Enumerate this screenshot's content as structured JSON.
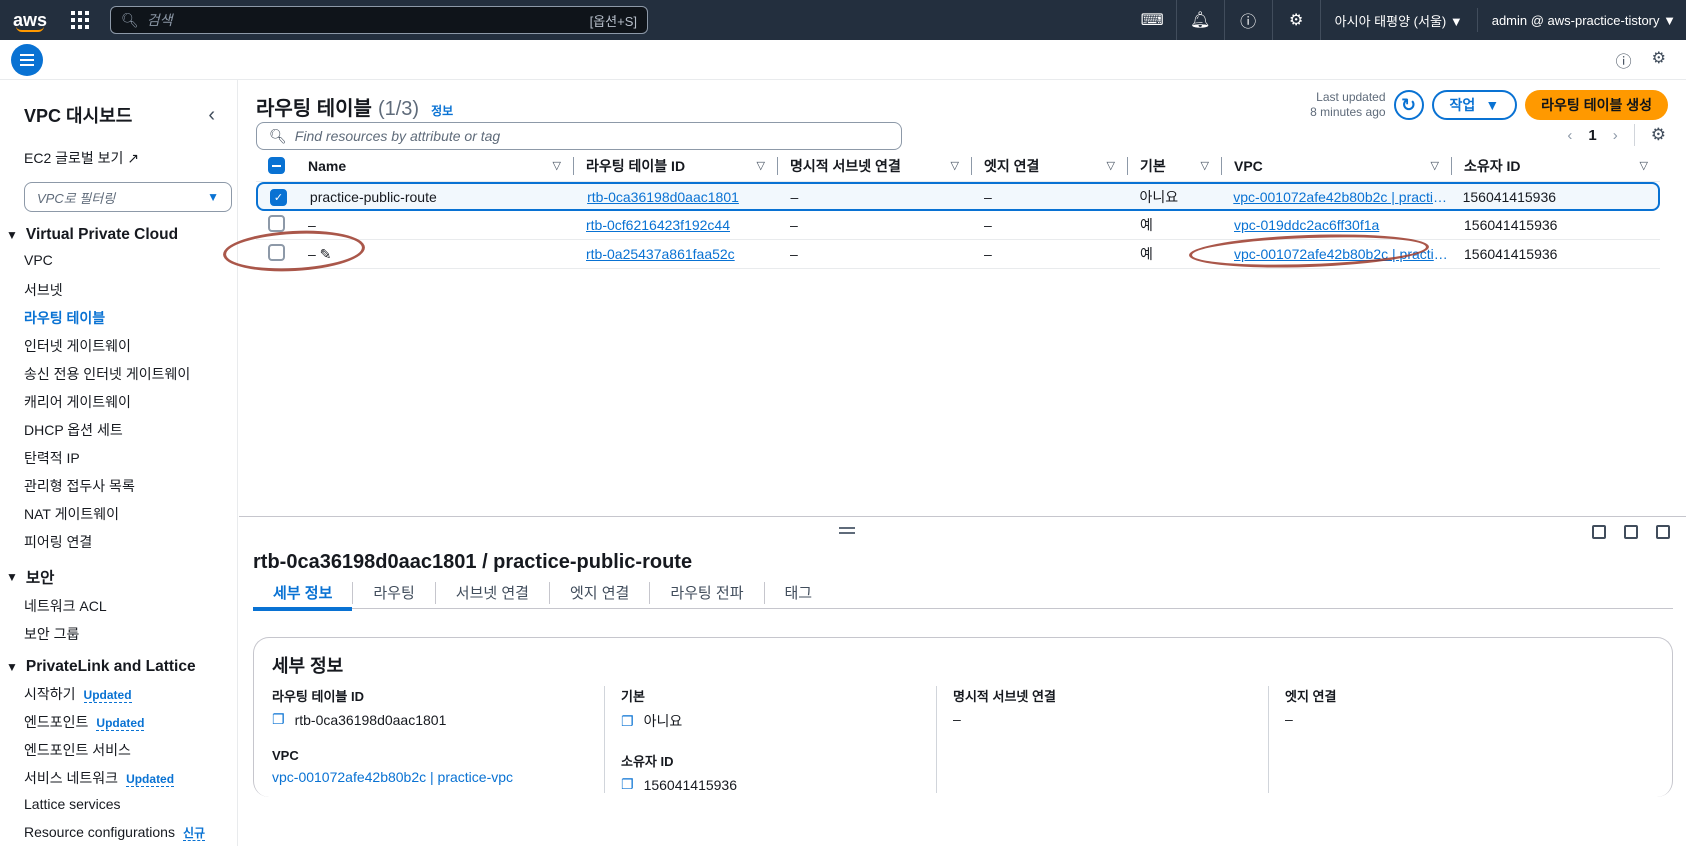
{
  "topnav": {
    "logo": "aws",
    "search_placeholder": "검색",
    "search_shortcut": "[옵션+S]",
    "region": "아시아 태평양 (서울) ▼",
    "account": "admin @ aws-practice-tistory ▼",
    "icons": [
      "cloudshell-icon",
      "bell-icon",
      "help-icon",
      "gear-icon"
    ]
  },
  "sidebar": {
    "title": "VPC 대시보드",
    "ec2_link": "EC2 글로벌 보기 ↗",
    "filter_placeholder": "VPC로 필터링",
    "sections": [
      {
        "title": "Virtual Private Cloud",
        "items": [
          "VPC",
          "서브넷",
          "라우팅 테이블",
          "인터넷 게이트웨이",
          "송신 전용 인터넷 게이트웨이",
          "캐리어 게이트웨이",
          "DHCP 옵션 세트",
          "탄력적 IP",
          "관리형 접두사 목록",
          "NAT 게이트웨이",
          "피어링 연결"
        ]
      },
      {
        "title": "보안",
        "items": [
          "네트워크 ACL",
          "보안 그룹"
        ]
      },
      {
        "title": "PrivateLink and Lattice",
        "items": [
          "시작하기",
          "엔드포인트",
          "엔드포인트 서비스",
          "서비스 네트워크",
          "Lattice services",
          "Resource configurations"
        ],
        "badges": [
          "Updated",
          "Updated",
          "",
          "Updated",
          "",
          "신규"
        ]
      }
    ],
    "active_item": "라우팅 테이블"
  },
  "main": {
    "title": "라우팅 테이블",
    "count": "(1/3)",
    "info": "정보",
    "last_updated_line1": "Last updated",
    "last_updated_line2": "8 minutes ago",
    "actions_button": "작업",
    "create_button": "라우팅 테이블 생성",
    "find_placeholder": "Find resources by attribute or tag",
    "page": "1",
    "columns": [
      "Name",
      "라우팅 테이블 ID",
      "명시적 서브넷 연결",
      "엣지 연결",
      "기본",
      "VPC",
      "소유자 ID"
    ],
    "rows": [
      {
        "selected": true,
        "name": "practice-public-route",
        "rtb": "rtb-0ca36198d0aac1801",
        "subnet": "–",
        "edge": "–",
        "main": "아니요",
        "vpc": "vpc-001072afe42b80b2c | practice-vpc",
        "owner": "156041415936"
      },
      {
        "selected": false,
        "name": "–",
        "rtb": "rtb-0cf6216423f192c44",
        "subnet": "–",
        "edge": "–",
        "main": "예",
        "vpc": "vpc-019ddc2ac6ff30f1a",
        "owner": "156041415936"
      },
      {
        "selected": false,
        "name": "– ✎",
        "rtb": "rtb-0a25437a861faa52c",
        "subnet": "–",
        "edge": "–",
        "main": "예",
        "vpc": "vpc-001072afe42b80b2c | practice-vpc",
        "owner": "156041415936"
      }
    ]
  },
  "detail": {
    "title": "rtb-0ca36198d0aac1801 / practice-public-route",
    "tabs": [
      "세부 정보",
      "라우팅",
      "서브넷 연결",
      "엣지 연결",
      "라우팅 전파",
      "태그"
    ],
    "card_title": "세부 정보",
    "fields": {
      "rtb_label": "라우팅 테이블 ID",
      "rtb_value": "rtb-0ca36198d0aac1801",
      "vpc_label": "VPC",
      "vpc_value": "vpc-001072afe42b80b2c | practice-vpc",
      "main_label": "기본",
      "main_value": "아니요",
      "owner_label": "소유자 ID",
      "owner_value": "156041415936",
      "subnet_label": "명시적 서브넷 연결",
      "subnet_value": "–",
      "edge_label": "엣지 연결",
      "edge_value": "–"
    }
  },
  "colors": {
    "accent": "#0972d3",
    "brand": "#ff9900",
    "nav_bg": "#232f3e",
    "annotation": "#9b3a2a"
  }
}
